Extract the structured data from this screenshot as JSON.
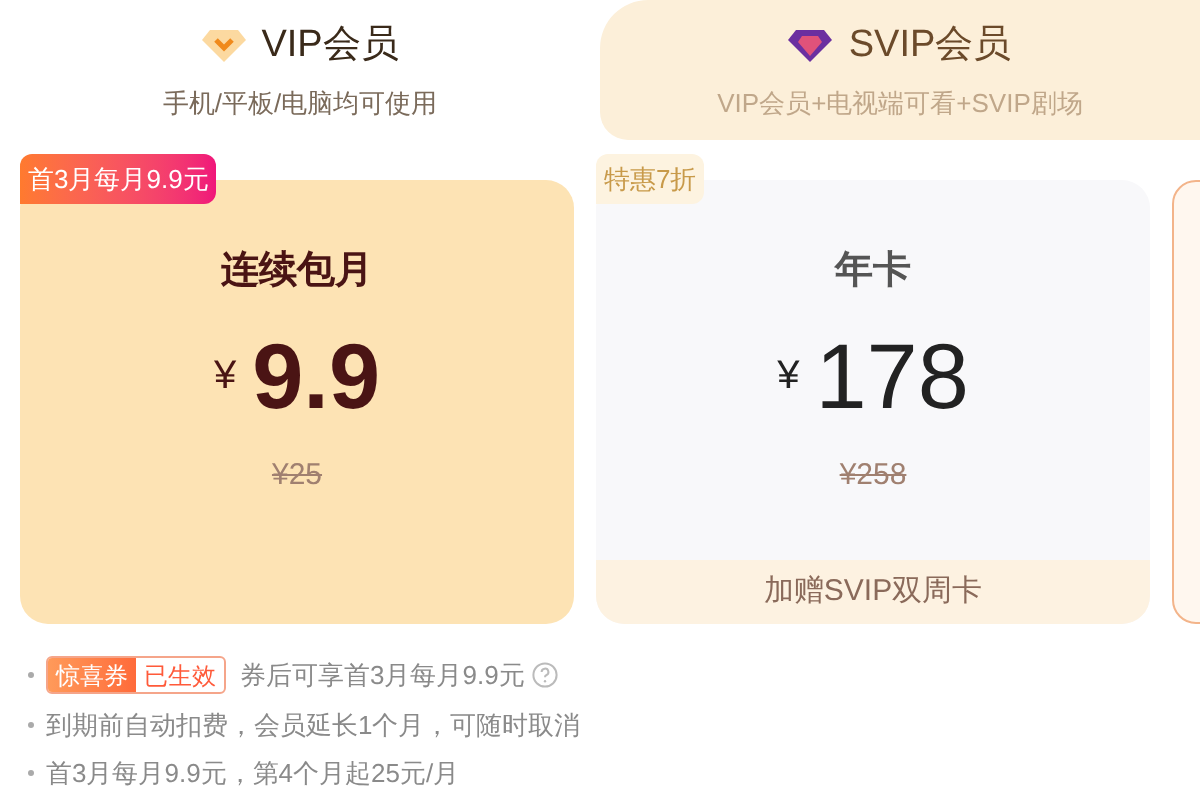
{
  "tabs": [
    {
      "title": "VIP会员",
      "subtitle": "手机/平板/电脑均可使用",
      "kind": "vip",
      "selected": true
    },
    {
      "title": "SVIP会员",
      "subtitle": "VIP会员+电视端可看+SVIP剧场",
      "kind": "svip",
      "selected": false
    }
  ],
  "plans": [
    {
      "badge": "首3月每月9.9元",
      "kind": "hot",
      "name": "连续包月",
      "currency": "¥",
      "price": "9.9",
      "original": "¥25",
      "selected": true
    },
    {
      "badge": "特惠7折",
      "kind": "plain",
      "name": "年卡",
      "currency": "¥",
      "price": "178",
      "original": "¥258",
      "extra": "加赠SVIP双周卡",
      "selected": false
    }
  ],
  "notes": [
    {
      "kind": "coupon",
      "coupon": "惊喜券",
      "status": "已生效",
      "text": "券后可享首3月每月9.9元"
    },
    {
      "kind": "plain",
      "text": "到期前自动扣费，会员延长1个月，可随时取消"
    },
    {
      "kind": "plain",
      "text": "首3月每月9.9元，第4个月起25元/月"
    }
  ]
}
